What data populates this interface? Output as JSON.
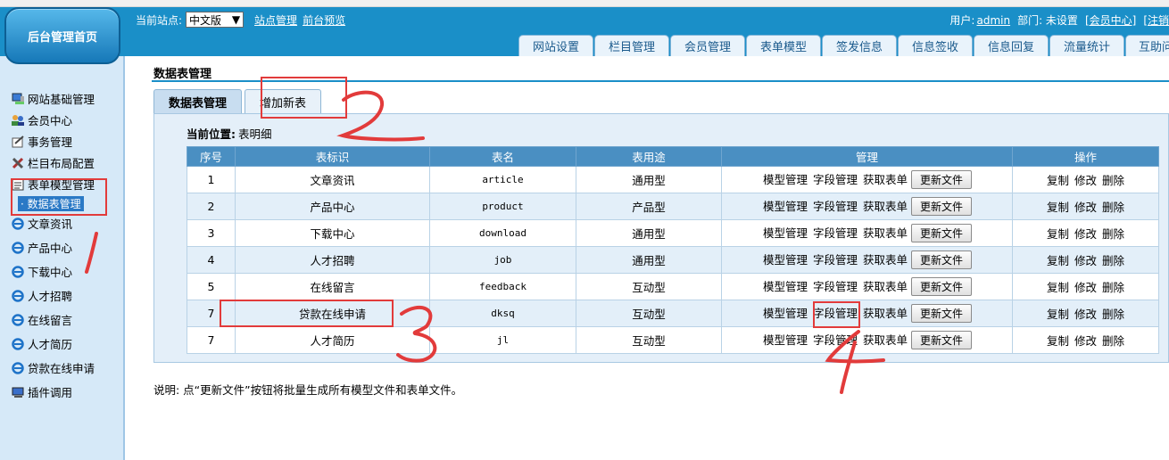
{
  "header": {
    "home_label": "后台管理首页",
    "current_site_label": "当前站点:",
    "site_select_value": "中文版",
    "site_manage_link": "站点管理",
    "front_preview_link": "前台预览",
    "user_label": "用户:",
    "user_name": "admin",
    "dept_label": "部门: 未设置",
    "member_center_link": "[会员中心]",
    "logout_link": "[注销"
  },
  "top_tabs": [
    "网站设置",
    "栏目管理",
    "会员管理",
    "表单模型",
    "签发信息",
    "信息签收",
    "信息回复",
    "流量统计",
    "互助问"
  ],
  "sidebar": {
    "items": [
      {
        "label": "网站基础管理",
        "icon": "computer-icon"
      },
      {
        "label": "会员中心",
        "icon": "users-icon"
      },
      {
        "label": "事务管理",
        "icon": "task-icon"
      },
      {
        "label": "栏目布局配置",
        "icon": "tools-icon"
      },
      {
        "label": "表单模型管理",
        "icon": "form-icon"
      },
      {
        "label": "文章资讯",
        "icon": "ie-icon"
      },
      {
        "label": "产品中心",
        "icon": "ie-icon"
      },
      {
        "label": "下载中心",
        "icon": "ie-icon"
      },
      {
        "label": "人才招聘",
        "icon": "ie-icon"
      },
      {
        "label": "在线留言",
        "icon": "ie-icon"
      },
      {
        "label": "人才简历",
        "icon": "ie-icon"
      },
      {
        "label": "贷款在线申请",
        "icon": "ie-icon"
      },
      {
        "label": "插件调用",
        "icon": "plugin-icon"
      }
    ],
    "active_sub": "· 数据表管理"
  },
  "main": {
    "title": "数据表管理",
    "subtabs": [
      "数据表管理",
      "增加新表"
    ],
    "crumb_label": "当前位置:",
    "crumb_value": "表明细",
    "columns": [
      "序号",
      "表标识",
      "表名",
      "表用途",
      "管理",
      "操作"
    ],
    "manage_links": [
      "模型管理",
      "字段管理",
      "获取表单"
    ],
    "update_button": "更新文件",
    "ops": [
      "复制",
      "修改",
      "删除"
    ],
    "rows": [
      {
        "no": "1",
        "label": "文章资讯",
        "name": "article",
        "use": "通用型"
      },
      {
        "no": "2",
        "label": "产品中心",
        "name": "product",
        "use": "产品型"
      },
      {
        "no": "3",
        "label": "下载中心",
        "name": "download",
        "use": "通用型"
      },
      {
        "no": "4",
        "label": "人才招聘",
        "name": "job",
        "use": "通用型"
      },
      {
        "no": "5",
        "label": "在线留言",
        "name": "feedback",
        "use": "互动型"
      },
      {
        "no": "7",
        "label": "贷款在线申请",
        "name": "dksq",
        "use": "互动型"
      },
      {
        "no": "7",
        "label": "人才简历",
        "name": "jl",
        "use": "互动型"
      }
    ],
    "note": "说明: 点“更新文件”按钮将批量生成所有模型文件和表单文件。"
  },
  "annotations": {
    "color": "#e23b3b",
    "numbers": [
      "1",
      "2",
      "3",
      "4"
    ]
  }
}
